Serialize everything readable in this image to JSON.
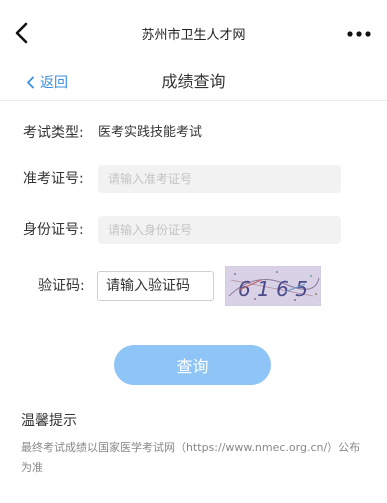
{
  "topbar": {
    "title": "苏州市卫生人才网",
    "back_icon": "chevron-left-icon",
    "more_icon": "more-dots-icon"
  },
  "subheader": {
    "back_label": "返回",
    "title": "成绩查询"
  },
  "form": {
    "exam_type_label": "考试类型:",
    "exam_type_value": "医考实践技能考试",
    "ticket_label": "准考证号:",
    "ticket_placeholder": "请输入准考证号",
    "id_label": "身份证号:",
    "id_placeholder": "请输入身份证号",
    "captcha_label": "验证码:",
    "captcha_placeholder": "请输入验证码",
    "captcha_text": "6 1 6 5",
    "submit_label": "查询"
  },
  "tips": {
    "title": "温馨提示",
    "text": "最终考试成绩以国家医学考试网（https://www.nmec.org.cn/）公布为准"
  },
  "colors": {
    "accent": "#3d8fe0",
    "button": "#8fc4f6",
    "field_bg": "#f2f2f2"
  }
}
